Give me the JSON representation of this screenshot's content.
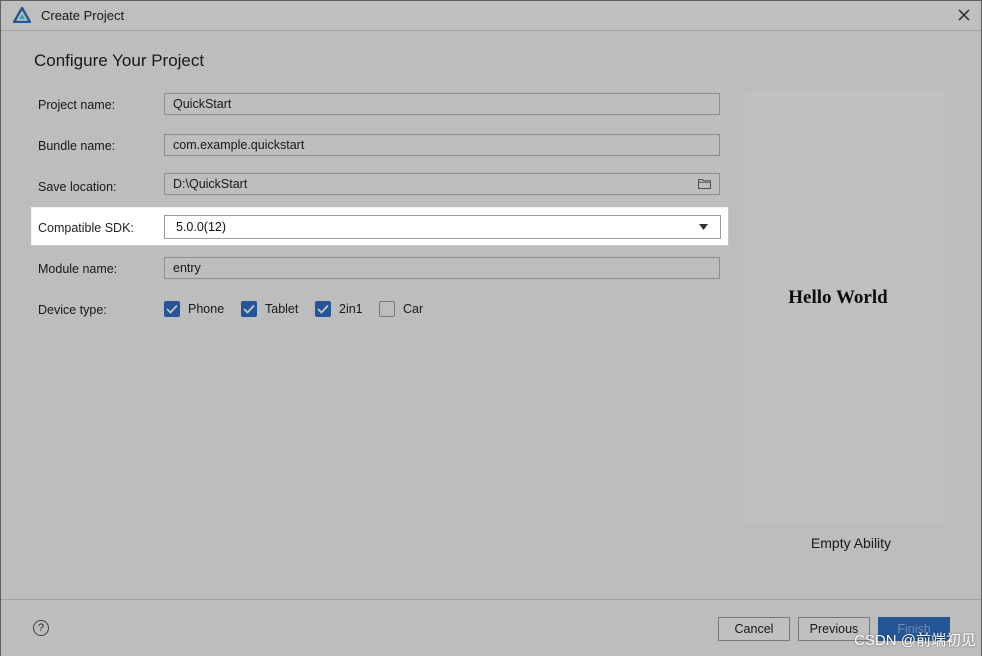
{
  "window": {
    "title": "Create Project",
    "logo_icon": "harmony-logo-icon",
    "close_icon": "close-icon"
  },
  "content": {
    "heading": "Configure Your Project"
  },
  "form": {
    "project_name": {
      "label": "Project name:",
      "value": "QuickStart"
    },
    "bundle_name": {
      "label": "Bundle name:",
      "value": "com.example.quickstart"
    },
    "save_location": {
      "label": "Save location:",
      "value": "D:\\QuickStart",
      "icon": "folder-icon"
    },
    "compatible_sdk": {
      "label": "Compatible SDK:",
      "value": "5.0.0(12)",
      "icon": "dropdown-arrow-icon"
    },
    "module_name": {
      "label": "Module name:",
      "value": "entry"
    },
    "device_type": {
      "label": "Device type:",
      "options": [
        {
          "label": "Phone",
          "checked": true
        },
        {
          "label": "Tablet",
          "checked": true
        },
        {
          "label": "2in1",
          "checked": true
        },
        {
          "label": "Car",
          "checked": false
        }
      ]
    }
  },
  "preview": {
    "text": "Hello World",
    "template_name": "Empty Ability"
  },
  "footer": {
    "help_label": "?",
    "cancel_label": "Cancel",
    "previous_label": "Previous",
    "finish_label": "Finish"
  },
  "watermark": "CSDN @前端初见",
  "colors": {
    "accent": "#2f6fc2",
    "dialog_bg": "#f2f2f2",
    "highlight_bg": "#ffffff"
  }
}
